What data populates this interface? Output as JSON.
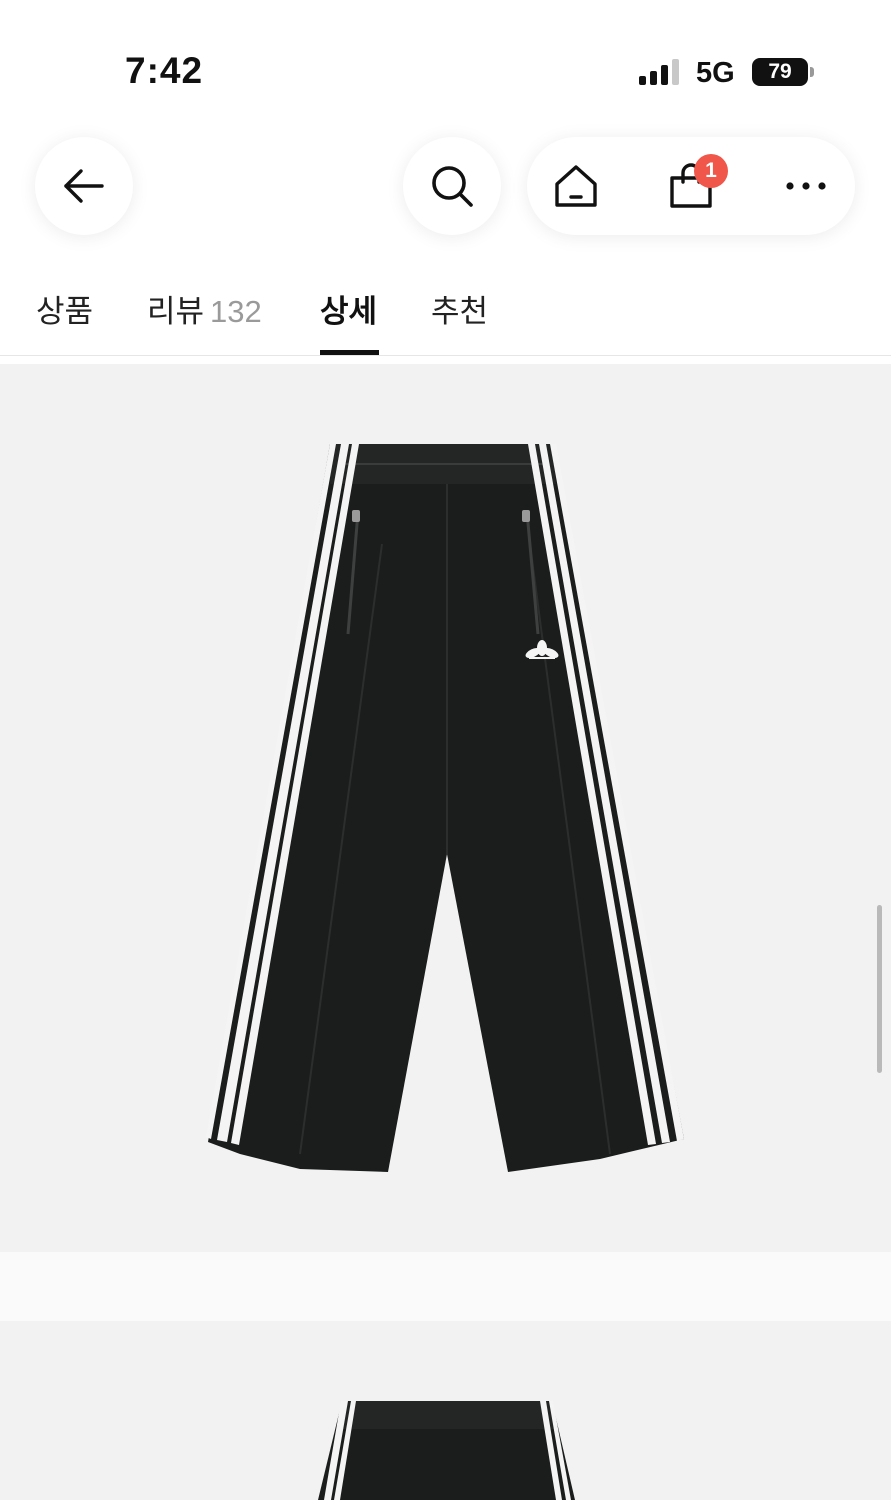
{
  "status_bar": {
    "time": "7:42",
    "network": "5G",
    "battery": "79",
    "signal_icon": "cellular-signal-icon"
  },
  "header": {
    "back_icon": "arrow-left-icon",
    "search_icon": "search-icon",
    "home_icon": "home-icon",
    "cart_icon": "shopping-bag-icon",
    "cart_badge": "1",
    "more_icon": "more-horizontal-icon",
    "badge_color": "#f0564a"
  },
  "tabs": [
    {
      "label": "상품"
    },
    {
      "label": "리뷰",
      "count": "132"
    },
    {
      "label": "상세",
      "active": true
    },
    {
      "label": "추천"
    }
  ],
  "product_images": [
    {
      "subject": "black track pants with three white stripes and trefoil logo"
    },
    {
      "subject": "black track pants (cropped)"
    }
  ]
}
